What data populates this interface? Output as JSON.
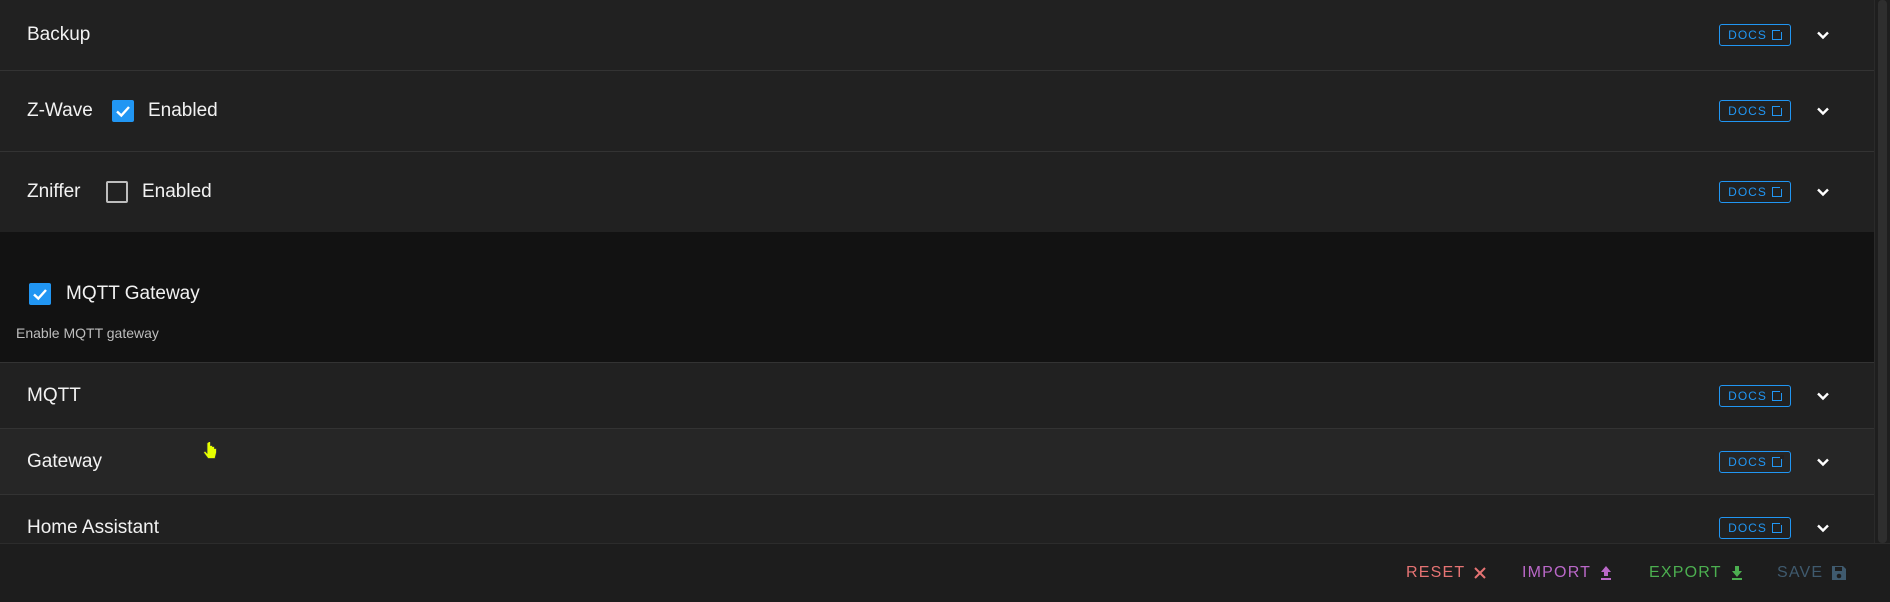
{
  "panels": [
    {
      "title": "Backup",
      "docs": "DOCS"
    },
    {
      "title": "Z-Wave",
      "docs": "DOCS",
      "checkbox_label": "Enabled",
      "checked": true
    },
    {
      "title": "Zniffer",
      "docs": "DOCS",
      "checkbox_label": "Enabled",
      "checked": false
    },
    {
      "title": "MQTT",
      "docs": "DOCS"
    },
    {
      "title": "Gateway",
      "docs": "DOCS"
    },
    {
      "title": "Home Assistant",
      "docs": "DOCS"
    }
  ],
  "mqtt_gateway": {
    "label": "MQTT Gateway",
    "checked": true,
    "hint": "Enable MQTT gateway"
  },
  "footer": {
    "reset": "RESET",
    "import": "IMPORT",
    "export": "EXPORT",
    "save": "SAVE"
  },
  "colors": {
    "accent": "#2196f3",
    "reset": "#e57373",
    "import": "#ba68c8",
    "export": "#4caf50",
    "save_disabled": "#3f5a6e"
  },
  "icons": {
    "panel_chevron": "chevron-down-icon",
    "docs": "open-in-new-icon",
    "reset": "close-icon",
    "import": "upload-icon",
    "export": "download-icon",
    "save": "floppy-disk-icon"
  }
}
